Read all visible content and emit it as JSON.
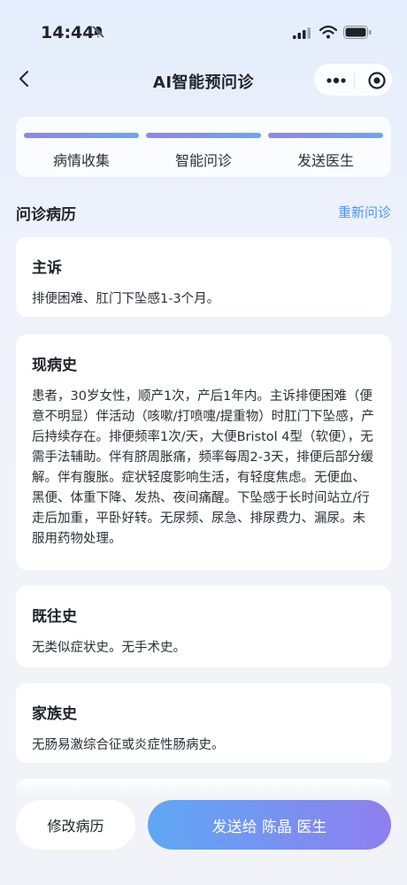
{
  "status_bar": {
    "time": "14:44"
  },
  "nav": {
    "title": "AI智能预问诊"
  },
  "steps": [
    {
      "label": "病情收集",
      "color": "#8f86ee"
    },
    {
      "label": "智能问诊",
      "color": "#8f86ee"
    },
    {
      "label": "发送医生",
      "color": "#8f86ee"
    }
  ],
  "section": {
    "title": "问诊病历",
    "action": "重新问诊"
  },
  "cards": {
    "chief": {
      "title": "主诉",
      "body": "排便困难、肛门下坠感1-3个月。"
    },
    "present": {
      "title": "现病史",
      "body": "患者，30岁女性，顺产1次，产后1年内。主诉排便困难（便意不明显）伴活动（咳嗽/打喷嚏/提重物）时肛门下坠感，产后持续存在。排便频率1次/天，大便Bristol 4型（软便），无需手法辅助。伴有脐周胀痛，频率每周2-3天，排便后部分缓解。伴有腹胀。症状轻度影响生活，有轻度焦虑。无便血、黑便、体重下降、发热、夜间痛醒。下坠感于长时间站立/行走后加重，平卧好转。无尿频、尿急、排尿费力、漏尿。未服用药物处理。"
    },
    "past": {
      "title": "既往史",
      "body": "无类似症状史。无手术史。"
    },
    "family": {
      "title": "家族史",
      "body": "无肠易激综合征或炎症性肠病史。"
    }
  },
  "actions": {
    "edit_label": "修改病历",
    "send_label": "发送给 陈晶 医生"
  },
  "colors": {
    "accent": "#4f95e6",
    "gradient_start": "#5fa8f5",
    "gradient_end": "#8f7fee"
  }
}
